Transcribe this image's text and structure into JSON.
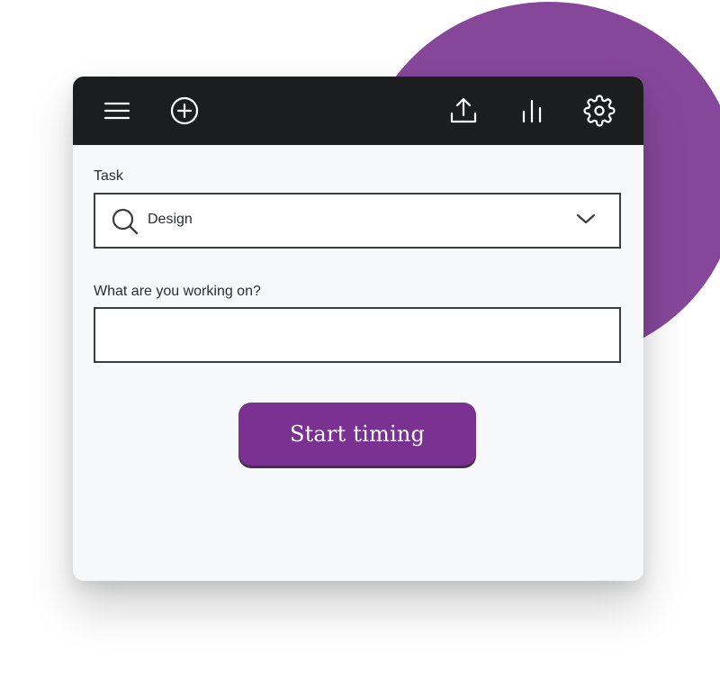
{
  "toolbar": {
    "icons": [
      "menu-icon",
      "add-circle-icon",
      "upload-icon",
      "stats-icon",
      "settings-icon"
    ]
  },
  "form": {
    "task_label": "Task",
    "task_value": "Design",
    "working_on_label": "What are you working on?",
    "working_on_value": ""
  },
  "actions": {
    "start_label": "Start timing"
  },
  "colors": {
    "brand": "#7b3192",
    "decor_circle": "#86479a",
    "toolbar": "#1b1d1f",
    "window_bg": "#f7f8fa"
  }
}
